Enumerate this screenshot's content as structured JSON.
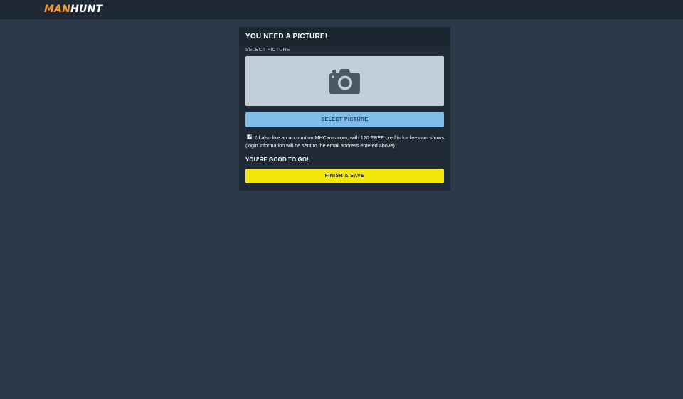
{
  "header": {
    "logo_part1": "MAN",
    "logo_part2": "HUNT"
  },
  "panel": {
    "title": "YOU NEED A PICTURE!",
    "select_label": "SELECT PICTURE",
    "picture_icon": "camera-icon",
    "select_button_label": "SELECT PICTURE",
    "checkbox_checked": true,
    "checkbox_text": "I'd also like an account on MHCams.com, with 120 FREE credits for live cam shows. (login information will be sent to the email address entered above)",
    "status_text": "YOU'RE GOOD TO GO!",
    "finish_button_label": "FINISH & SAVE"
  },
  "colors": {
    "background": "#2a3a4a",
    "topbar": "#1f2935",
    "panel": "#1f2a36",
    "picture_area": "#c2ceda",
    "select_button": "#7fbde8",
    "finish_button": "#f2e60a",
    "logo_accent": "#f39c2c"
  }
}
